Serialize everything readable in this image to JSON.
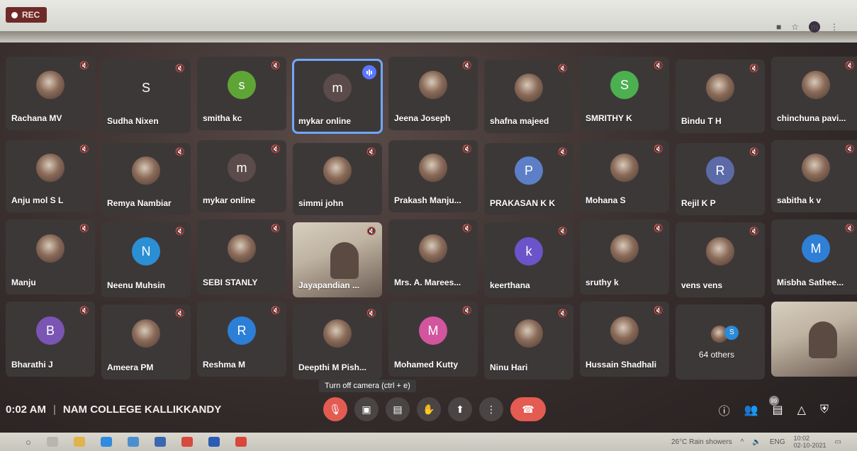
{
  "browser": {
    "recording_label": "REC",
    "profile_initial": "m"
  },
  "participants": [
    {
      "name": "Rachana MV",
      "kind": "photo"
    },
    {
      "name": "Sudha Nixen",
      "kind": "letter",
      "initial": "S",
      "color": "#3d3838"
    },
    {
      "name": "smitha kc",
      "kind": "letter",
      "initial": "s",
      "color": "#5fa535"
    },
    {
      "name": "mykar online",
      "kind": "letter",
      "initial": "m",
      "color": "#5b4b4b",
      "speaking": true
    },
    {
      "name": "Jeena Joseph",
      "kind": "photo"
    },
    {
      "name": "shafna majeed",
      "kind": "photo"
    },
    {
      "name": "SMRITHY K",
      "kind": "letter",
      "initial": "S",
      "color": "#4caf50"
    },
    {
      "name": "Bindu T H",
      "kind": "photo"
    },
    {
      "name": "chinchuna pavi...",
      "kind": "photo"
    },
    {
      "name": "Anju mol S L",
      "kind": "photo"
    },
    {
      "name": "Remya Nambiar",
      "kind": "photo"
    },
    {
      "name": "mykar online",
      "kind": "letter",
      "initial": "m",
      "color": "#5b4b4b"
    },
    {
      "name": "simmi john",
      "kind": "photo"
    },
    {
      "name": "Prakash Manju...",
      "kind": "photo"
    },
    {
      "name": "PRAKASAN K K",
      "kind": "letter",
      "initial": "P",
      "color": "#5c7fc7"
    },
    {
      "name": "Mohana S",
      "kind": "photo"
    },
    {
      "name": "Rejil K P",
      "kind": "letter",
      "initial": "R",
      "color": "#5d6aa8"
    },
    {
      "name": "sabitha k v",
      "kind": "photo"
    },
    {
      "name": "Manju",
      "kind": "photo"
    },
    {
      "name": "Neenu Muhsin",
      "kind": "letter",
      "initial": "N",
      "color": "#2b8fd4"
    },
    {
      "name": "SEBI STANLY",
      "kind": "photo"
    },
    {
      "name": "Jayapandian ...",
      "kind": "video"
    },
    {
      "name": "Mrs. A. Marees...",
      "kind": "photo"
    },
    {
      "name": "keerthana",
      "kind": "letter",
      "initial": "k",
      "color": "#6b54c9"
    },
    {
      "name": "sruthy k",
      "kind": "photo"
    },
    {
      "name": "vens vens",
      "kind": "photo"
    },
    {
      "name": "Misbha Sathee...",
      "kind": "letter",
      "initial": "M",
      "color": "#2f7fd6"
    },
    {
      "name": "Bharathi J",
      "kind": "letter",
      "initial": "B",
      "color": "#7a55b3"
    },
    {
      "name": "Ameera PM",
      "kind": "photo"
    },
    {
      "name": "Reshma M",
      "kind": "letter",
      "initial": "R",
      "color": "#2c7fd7"
    },
    {
      "name": "Deepthi M Pish...",
      "kind": "photo"
    },
    {
      "name": "Mohamed Kutty",
      "kind": "letter",
      "initial": "M",
      "color": "#d3559e"
    },
    {
      "name": "Ninu Hari",
      "kind": "photo"
    },
    {
      "name": "Hussain Shadhali",
      "kind": "photo"
    },
    {
      "name": "64 others",
      "kind": "others"
    },
    {
      "name": "",
      "kind": "self-video"
    }
  ],
  "meeting": {
    "time": "0:02 AM",
    "title": "NAM COLLEGE KALLIKKANDY",
    "tooltip": "Turn off camera (ctrl + e)",
    "participant_count": "99"
  },
  "taskbar": {
    "weather": "26°C  Rain showers",
    "language": "ENG",
    "time": "10:02",
    "date": "02-10-2021"
  }
}
